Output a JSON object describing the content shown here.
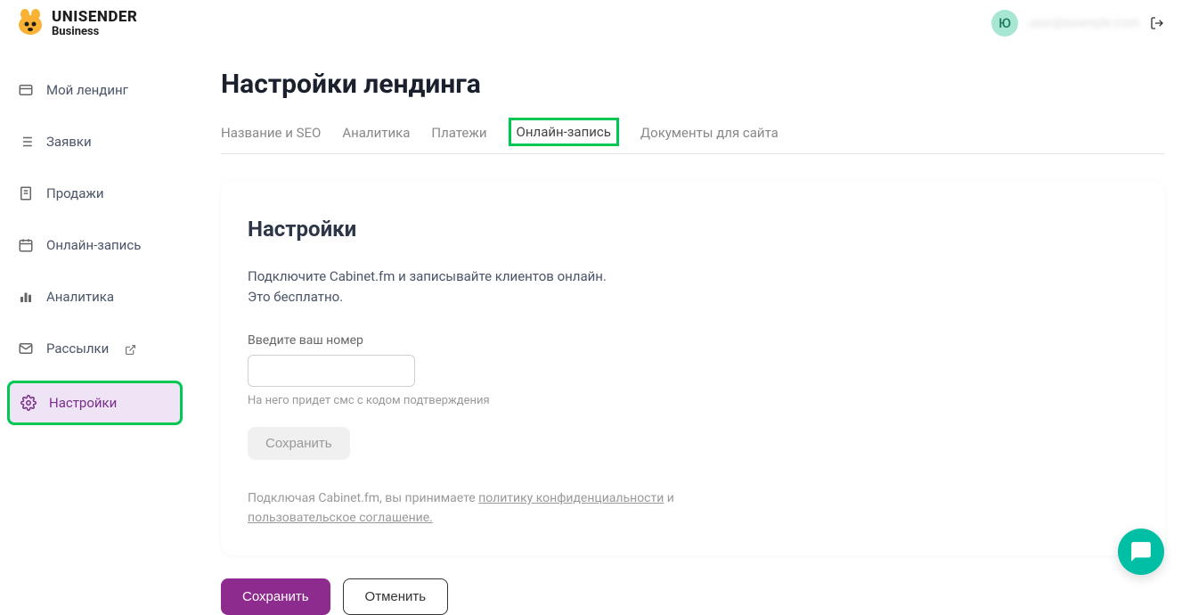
{
  "logo": {
    "brand": "UNISENDER",
    "sub": "Business"
  },
  "user": {
    "initial": "Ю",
    "email": "user@example.com"
  },
  "sidebar": {
    "items": [
      {
        "label": "Мой лендинг"
      },
      {
        "label": "Заявки"
      },
      {
        "label": "Продажи"
      },
      {
        "label": "Онлайн-запись"
      },
      {
        "label": "Аналитика"
      },
      {
        "label": "Рассылки"
      },
      {
        "label": "Настройки"
      }
    ]
  },
  "page": {
    "title": "Настройки лендинга"
  },
  "tabs": [
    {
      "label": "Название и SEO"
    },
    {
      "label": "Аналитика"
    },
    {
      "label": "Платежи"
    },
    {
      "label": "Онлайн-запись"
    },
    {
      "label": "Документы для сайта"
    }
  ],
  "card": {
    "title": "Настройки",
    "desc_line1": "Подключите Cabinet.fm и записывайте клиентов онлайн.",
    "desc_line2": "Это бесплатно.",
    "field_label": "Введите ваш номер",
    "field_hint": "На него придет смс с кодом подтверждения",
    "inner_save": "Сохранить",
    "legal_prefix": "Подключая Cabinet.fm, вы принимаете ",
    "legal_privacy": "политику конфиденциальности",
    "legal_and": " и ",
    "legal_terms": "пользовательское соглашение."
  },
  "footer": {
    "save": "Сохранить",
    "cancel": "Отменить"
  }
}
